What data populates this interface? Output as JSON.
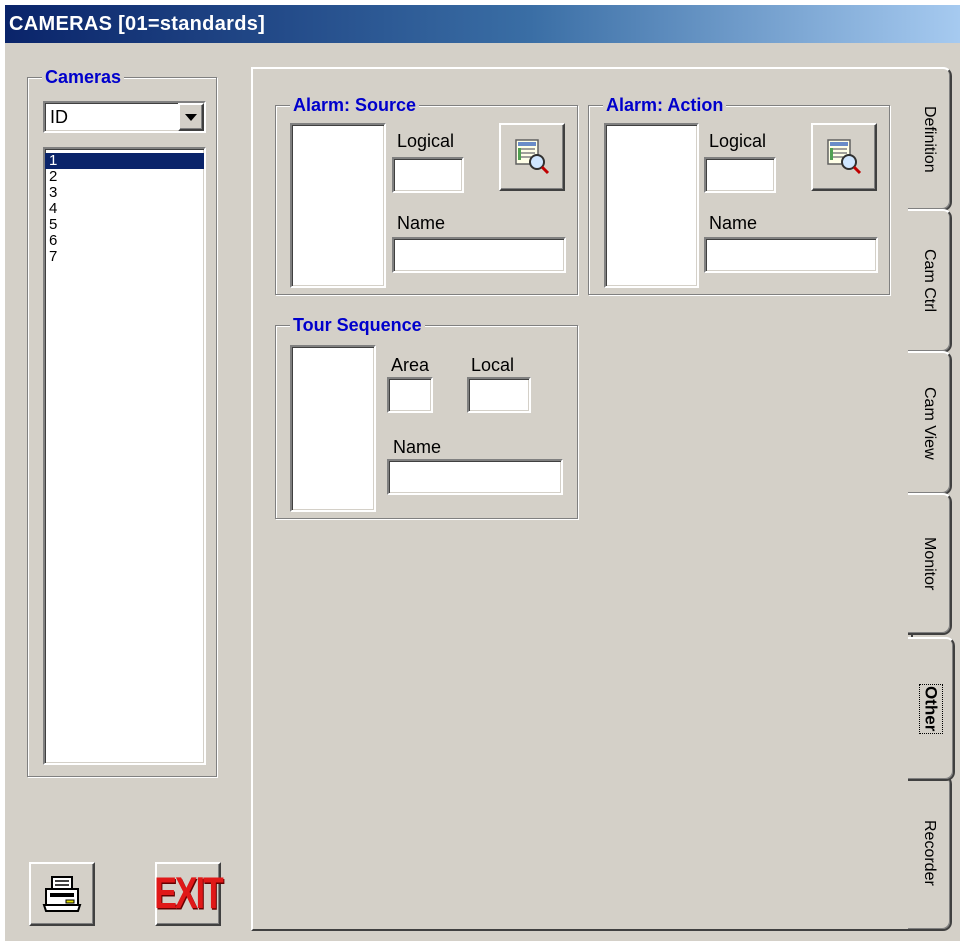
{
  "window": {
    "title": "CAMERAS [01=standards]"
  },
  "cameras": {
    "group_title": "Cameras",
    "sort_select": {
      "value": "ID"
    },
    "list": [
      {
        "label": "1",
        "selected": true
      },
      {
        "label": "2",
        "selected": false
      },
      {
        "label": "3",
        "selected": false
      },
      {
        "label": "4",
        "selected": false
      },
      {
        "label": "5",
        "selected": false
      },
      {
        "label": "6",
        "selected": false
      },
      {
        "label": "7",
        "selected": false
      }
    ]
  },
  "toolbar": {
    "print_icon": "printer-icon",
    "exit_label": "EXIT"
  },
  "tabs": [
    {
      "label": "Definition",
      "active": false
    },
    {
      "label": "Cam Ctrl",
      "active": false
    },
    {
      "label": "Cam View",
      "active": false
    },
    {
      "label": "Monitor",
      "active": false
    },
    {
      "label": "Other",
      "active": true
    },
    {
      "label": "Recorder",
      "active": false
    }
  ],
  "alarm_source": {
    "title": "Alarm: Source",
    "logical_label": "Logical",
    "logical_value": "",
    "name_label": "Name",
    "name_value": "",
    "lookup_icon": "lookup-magnifier-icon"
  },
  "alarm_action": {
    "title": "Alarm: Action",
    "logical_label": "Logical",
    "logical_value": "",
    "name_label": "Name",
    "name_value": "",
    "lookup_icon": "lookup-magnifier-icon"
  },
  "tour_sequence": {
    "title": "Tour Sequence",
    "area_label": "Area",
    "area_value": "",
    "local_label": "Local",
    "local_value": "",
    "name_label": "Name",
    "name_value": ""
  },
  "colors": {
    "face": "#d4d0c8",
    "group_title": "#0000cc",
    "selection": "#0a246a",
    "exit_red": "#e01818"
  }
}
